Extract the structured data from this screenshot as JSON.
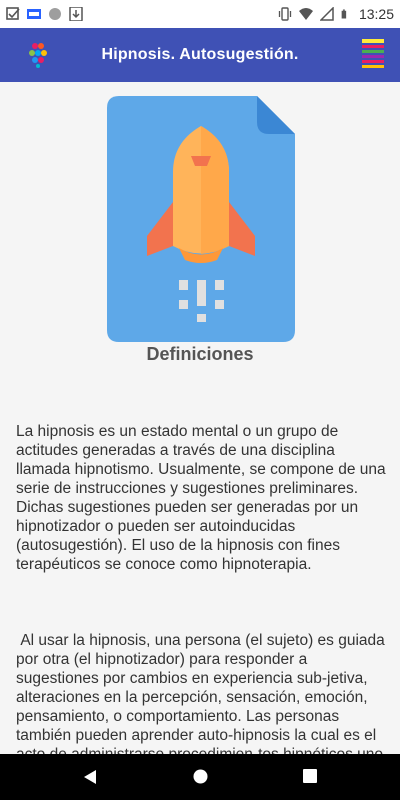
{
  "status_bar": {
    "time": "13:25",
    "icons": [
      "checkbox-notification-icon",
      "news-notification-icon",
      "circle-notification-icon",
      "download-notification-icon",
      "vibrate-icon",
      "wifi-icon",
      "signal-icon",
      "battery-icon"
    ]
  },
  "app_bar": {
    "title": "Hipnosis. Autosugestión.",
    "color": "#3f51b5"
  },
  "content": {
    "section_title": "Definiciones",
    "paragraph_1": "La hipnosis es un estado mental o un grupo de actitudes generadas a través de una disciplina llamada hipnotismo. Usualmente, se compone de una serie de instrucciones y sugestiones preliminares.  Dichas sugestiones pueden ser generadas por un hipnotizador o pueden ser autoinducidas (autosugestión). El uso de la hipnosis con fines terapéuticos se conoce como hipnoterapia.",
    "paragraph_2": " Al usar la hipnosis, una persona (el sujeto) es guiada por otra (el hipnotizador) para responder a sugestiones por cambios en experiencia sub-jetiva, alteraciones en la percepción, sensación, emoción, pensamiento, o comportamiento. Las personas también pueden aprender auto-hipnosis la cual es el acto de administrarse procedimien-tos hipnóticos uno mismo. Si el sujeto responde a sugestiones hipnóticas, generalmente infiere en"
  },
  "nav_bar": {
    "buttons": [
      "back-icon",
      "home-icon",
      "recents-icon"
    ]
  }
}
